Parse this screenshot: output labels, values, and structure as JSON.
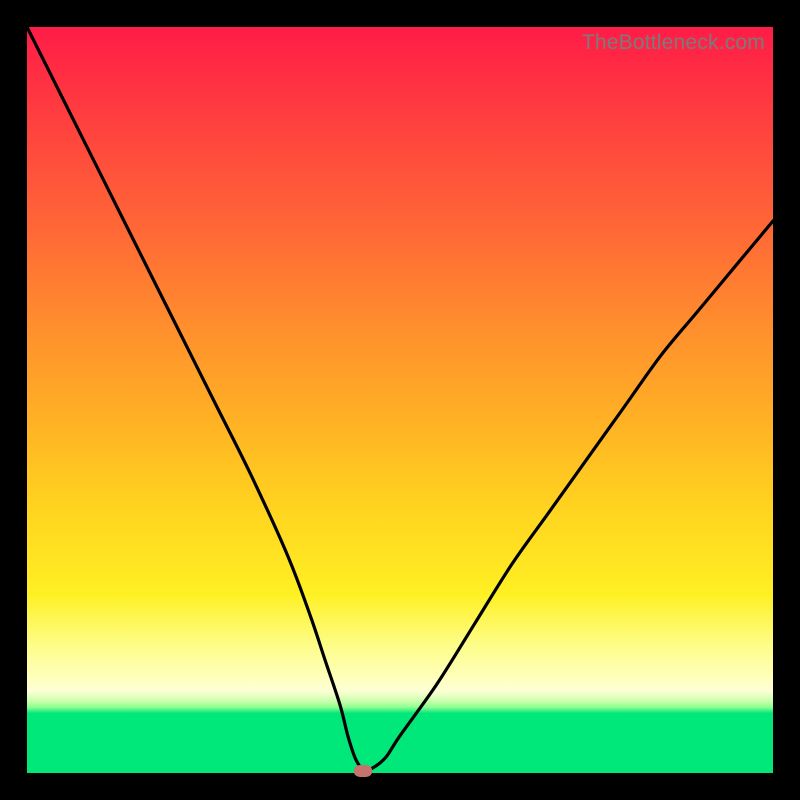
{
  "watermark": "TheBottleneck.com",
  "colors": {
    "frame_border": "#000000",
    "curve_stroke": "#000000",
    "marker_fill": "#c4746d",
    "gradient_stops": [
      "#ff1c47",
      "#ff3e3f",
      "#ff6a35",
      "#ff8e2d",
      "#ffaf25",
      "#ffd21f",
      "#fff023",
      "#fdfd8a",
      "#ffffc0",
      "#fcffd4",
      "#ceffb0",
      "#8cff8f",
      "#00e77a"
    ]
  },
  "chart_data": {
    "type": "line",
    "title": "",
    "xlabel": "",
    "ylabel": "",
    "xlim": [
      0,
      100
    ],
    "ylim": [
      0,
      100
    ],
    "grid": false,
    "legend": false,
    "series": [
      {
        "name": "bottleneck-curve",
        "x": [
          0,
          5,
          10,
          15,
          20,
          25,
          30,
          35,
          38,
          40,
          42,
          43,
          44,
          45,
          46,
          48,
          50,
          55,
          60,
          65,
          70,
          75,
          80,
          85,
          90,
          95,
          100
        ],
        "y": [
          100,
          90,
          80,
          70,
          60,
          50,
          40,
          29,
          21,
          15,
          9,
          5,
          2,
          0.5,
          0.5,
          2,
          5,
          12,
          20,
          28,
          35,
          42,
          49,
          56,
          62,
          68,
          74
        ]
      }
    ],
    "marker": {
      "x": 45,
      "y": 0
    },
    "background_bands_pct_from_top": {
      "red_to_yellow_gradient_end": 88,
      "green_band_start": 91
    }
  }
}
